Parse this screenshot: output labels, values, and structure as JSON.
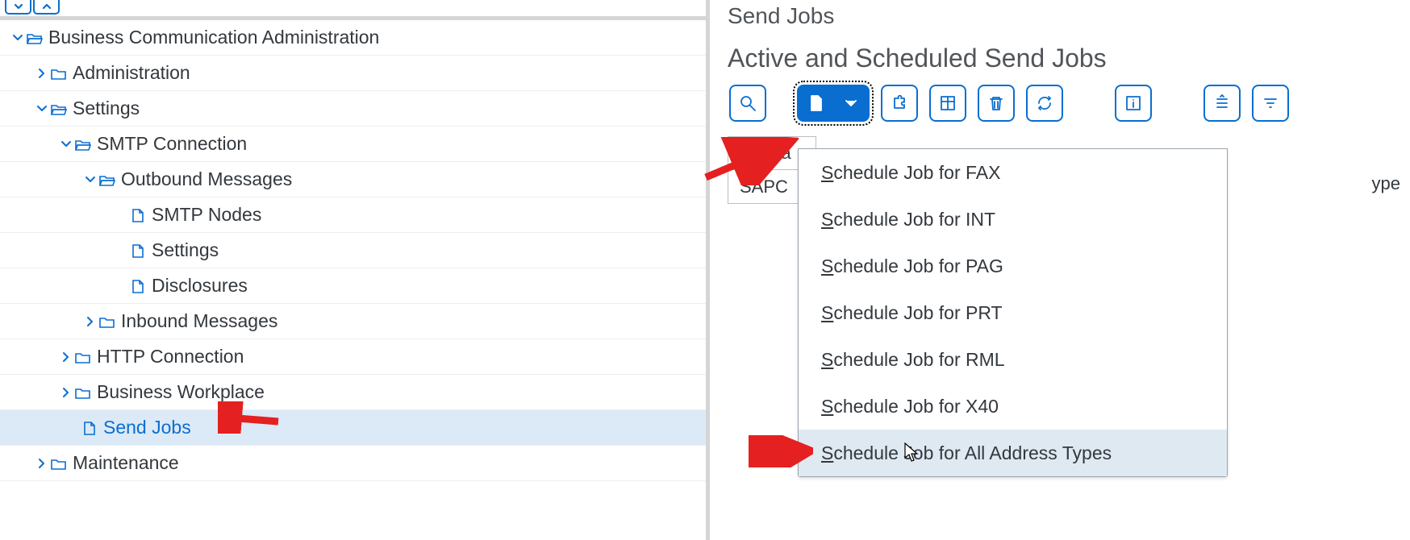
{
  "tree": {
    "root_label": "Business Communication Administration",
    "administration": "Administration",
    "settings": "Settings",
    "smtp_connection": "SMTP Connection",
    "outbound_messages": "Outbound Messages",
    "smtp_nodes": "SMTP Nodes",
    "settings_leaf": "Settings",
    "disclosures": "Disclosures",
    "inbound_messages": "Inbound Messages",
    "http_connection": "HTTP Connection",
    "business_workplace": "Business Workplace",
    "send_jobs": "Send Jobs",
    "maintenance": "Maintenance"
  },
  "right": {
    "view_title": "Send Jobs",
    "section_title": "Active and Scheduled Send Jobs",
    "col_jobname": "JobNa",
    "cell_sapc": "SAPC",
    "col_type_fragment": "ype"
  },
  "dropdown": {
    "items": [
      {
        "pre": "S",
        "rest": "chedule Job for FAX"
      },
      {
        "pre": "S",
        "rest": "chedule Job for INT"
      },
      {
        "pre": "S",
        "rest": "chedule Job for PAG"
      },
      {
        "pre": "S",
        "rest": "chedule Job for PRT"
      },
      {
        "pre": "S",
        "rest": "chedule Job for RML"
      },
      {
        "pre": "S",
        "rest": "chedule Job for X40"
      },
      {
        "pre": "S",
        "rest": "chedule Job for All Address Types"
      }
    ]
  }
}
